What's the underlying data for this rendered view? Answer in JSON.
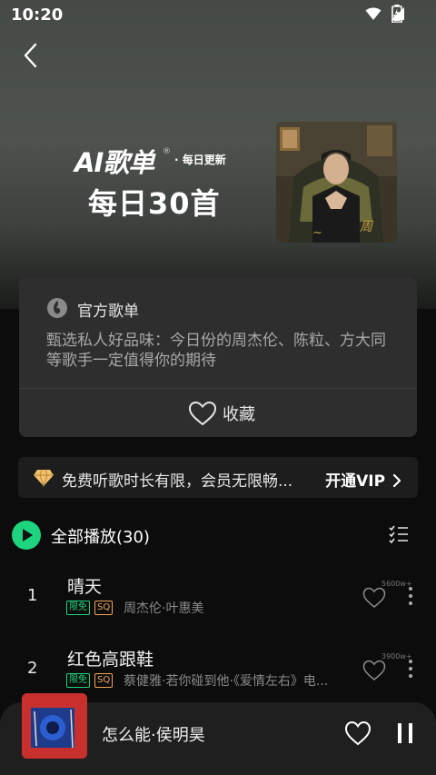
{
  "status_bar": {
    "time": "10:20"
  },
  "hero": {
    "ai_logo": "AI歌单",
    "ai_reg": "®",
    "ai_sub": "· 每日更新",
    "title": "每日30首"
  },
  "info_card": {
    "official_label": "官方歌单",
    "description": "甄选私人好品味：今日份的周杰伦、陈粒、方大同等歌手一定值得你的期待",
    "collect_label": "收藏"
  },
  "vip_bar": {
    "text": "免费听歌时长有限，会员无限畅...",
    "action": "开通VIP"
  },
  "play_all": {
    "label": "全部播放(30)"
  },
  "songs": [
    {
      "num": "1",
      "title": "晴天",
      "tag_free": "限免",
      "tag_sq": "SQ",
      "artist": "周杰伦·叶惠美",
      "likes": "5600w+"
    },
    {
      "num": "2",
      "title": "红色高跟鞋",
      "tag_free": "限免",
      "tag_sq": "SQ",
      "artist": "蔡健雅·若你碰到他·《爱情左右》电...",
      "likes": "3900w+"
    }
  ],
  "player": {
    "title": "怎么能·侯明昊"
  },
  "colors": {
    "accent_green": "#1ed47f",
    "sq_orange": "#f0a65a",
    "vip_gold": "#f2c06b"
  },
  "icons": [
    "back-arrow-icon",
    "wifi-icon",
    "signal-icon",
    "battery-icon",
    "official-badge-icon",
    "heart-icon",
    "diamond-icon",
    "chevron-right-icon",
    "play-icon",
    "multiselect-icon",
    "more-icon",
    "pause-icon"
  ]
}
